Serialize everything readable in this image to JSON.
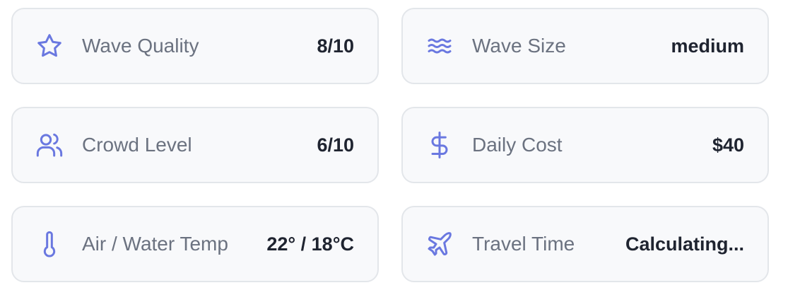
{
  "colors": {
    "icon": "#6a78e0",
    "label": "#6b7280",
    "value": "#1f2430",
    "card_bg": "#f8f9fb",
    "card_border": "#e3e6ea"
  },
  "stats": [
    {
      "icon": "star-icon",
      "label": "Wave Quality",
      "value": "8/10"
    },
    {
      "icon": "waves-icon",
      "label": "Wave Size",
      "value": "medium"
    },
    {
      "icon": "users-icon",
      "label": "Crowd Level",
      "value": "6/10"
    },
    {
      "icon": "dollar-icon",
      "label": "Daily Cost",
      "value": "$40"
    },
    {
      "icon": "thermometer-icon",
      "label": "Air / Water Temp",
      "value": "22° / 18°C"
    },
    {
      "icon": "plane-icon",
      "label": "Travel Time",
      "value": "Calculating..."
    }
  ]
}
